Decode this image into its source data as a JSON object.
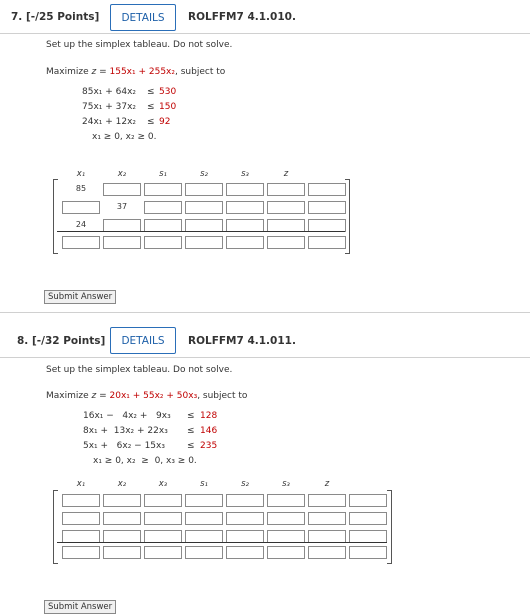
{
  "q7": {
    "number": "7. [-/25 Points]",
    "details_label": "DETAILS",
    "code": "ROLFFM7 4.1.010.",
    "instruction": "Set up the simplex tableau. Do not solve.",
    "objective": {
      "prefix": "Maximize ",
      "var": "z",
      "eq": " = ",
      "expr": "155x₁ + 255x₂",
      "suffix": ",  subject to"
    },
    "constraints": [
      {
        "lhs": "85x₁ + 64x₂",
        "op": "≤",
        "rhs": "530"
      },
      {
        "lhs": "75x₁ + 37x₂",
        "op": "≤",
        "rhs": "150"
      },
      {
        "lhs": "24x₁ + 12x₂",
        "op": "≤",
        "rhs": "92"
      },
      {
        "lhs": "x₁ ≥ 0, x₂ ≥ 0.",
        "op": "",
        "rhs": ""
      }
    ],
    "headers": [
      "x₁",
      "x₂",
      "s₁",
      "s₂",
      "s₃",
      "z",
      ""
    ],
    "rows": [
      [
        "85",
        "",
        "",
        "",
        "",
        "",
        ""
      ],
      [
        "",
        "37",
        "",
        "",
        "",
        "",
        ""
      ],
      [
        "24",
        "",
        "",
        "",
        "",
        "",
        ""
      ],
      [
        "",
        "",
        "",
        "",
        "",
        "",
        ""
      ]
    ],
    "submit_label": "Submit Answer"
  },
  "q8": {
    "number": "8. [-/32 Points]",
    "details_label": "DETAILS",
    "code": "ROLFFM7 4.1.011.",
    "instruction": "Set up the simplex tableau. Do not solve.",
    "objective": {
      "prefix": "Maximize ",
      "var": "z",
      "eq": " = ",
      "expr": "20x₁ + 55x₂ + 50x₃",
      "suffix": ",  subject to"
    },
    "constraints": [
      {
        "lhs": "16x₁ −   4x₂ +   9x₃",
        "op": "≤",
        "rhs": "128"
      },
      {
        "lhs": "8x₁ +  13x₂ + 22x₃",
        "op": "≤",
        "rhs": "146"
      },
      {
        "lhs": "5x₁ +   6x₂ − 15x₃",
        "op": "≤",
        "rhs": "235"
      },
      {
        "lhs": "x₁ ≥ 0, x₂  ≥  0, x₃ ≥ 0.",
        "op": "",
        "rhs": ""
      }
    ],
    "headers": [
      "x₁",
      "x₂",
      "x₃",
      "s₁",
      "s₂",
      "s₃",
      "z",
      ""
    ],
    "rows": [
      [
        "",
        "",
        "",
        "",
        "",
        "",
        "",
        ""
      ],
      [
        "",
        "",
        "",
        "",
        "",
        "",
        "",
        ""
      ],
      [
        "",
        "",
        "",
        "",
        "",
        "",
        "",
        ""
      ],
      [
        "",
        "",
        "",
        "",
        "",
        "",
        "",
        ""
      ]
    ],
    "submit_label": "Submit Answer"
  },
  "colors": {
    "accent": "#1d5fa8",
    "rhs_red": "#c00000"
  }
}
